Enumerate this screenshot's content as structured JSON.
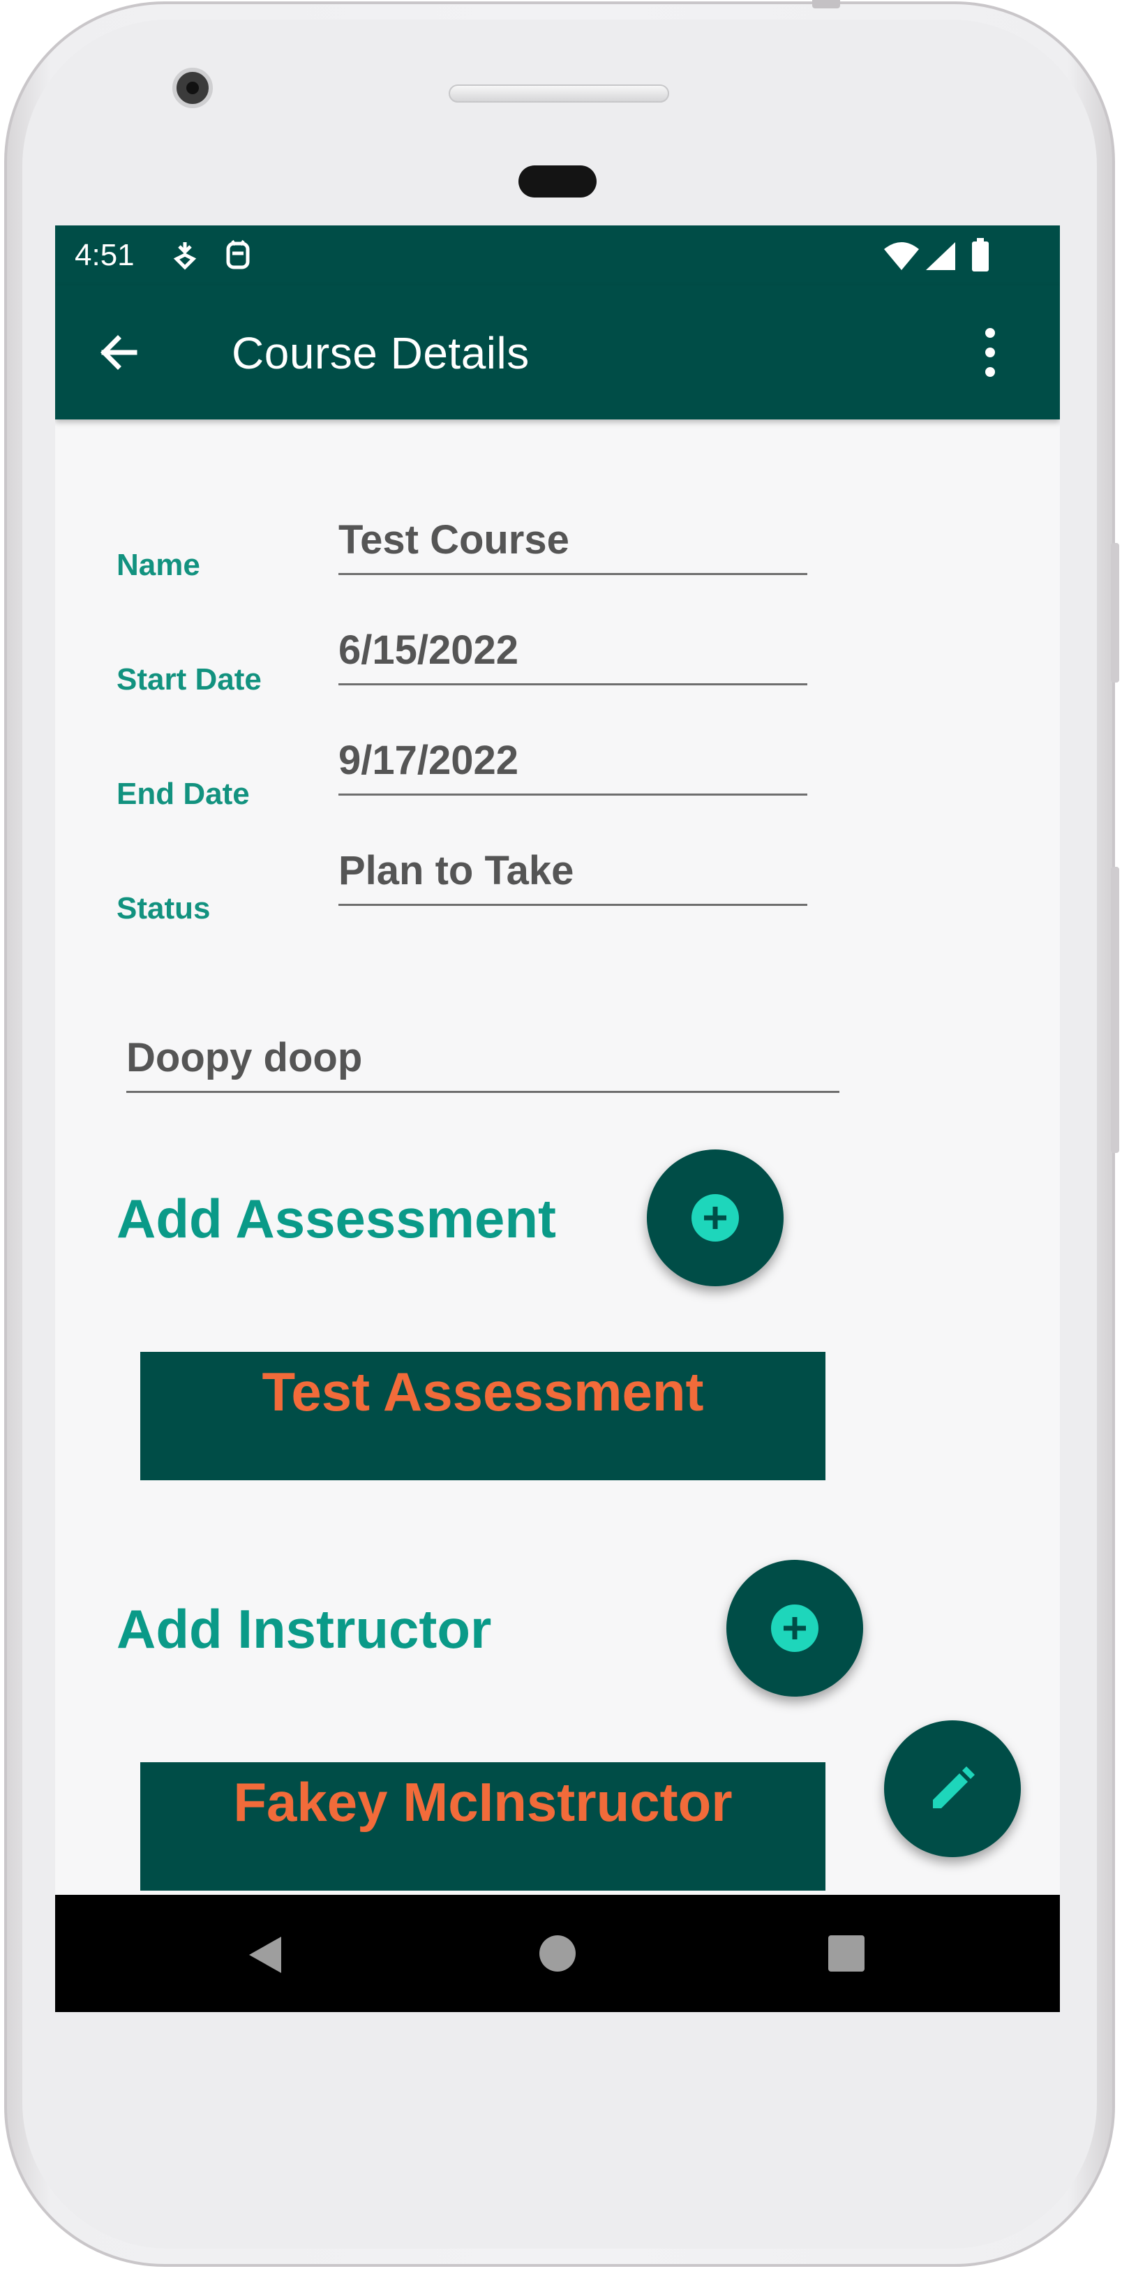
{
  "status_bar": {
    "time": "4:51"
  },
  "app_bar": {
    "title": "Course Details"
  },
  "form": {
    "name_label": "Name",
    "name_value": "Test Course",
    "start_label": "Start Date",
    "start_value": "6/15/2022",
    "end_label": "End Date",
    "end_value": "9/17/2022",
    "status_label": "Status",
    "status_value": "Plan to Take",
    "notes_value": "Doopy doop"
  },
  "assessments": {
    "section_title": "Add Assessment",
    "items": [
      "Test Assessment"
    ]
  },
  "instructors": {
    "section_title": "Add Instructor",
    "items": [
      "Fakey McInstructor"
    ]
  },
  "colors": {
    "primary_dark": "#004d47",
    "accent_teal": "#1ed6bb",
    "label_teal": "#12927f",
    "card_text_orange": "#f26b3a"
  },
  "icons": {
    "back": "arrow-left-icon",
    "menu": "more-vertical-icon",
    "add": "plus-circle-icon",
    "edit": "pencil-icon",
    "nav_back": "triangle-back-icon",
    "nav_home": "circle-home-icon",
    "nav_recents": "square-recents-icon"
  }
}
